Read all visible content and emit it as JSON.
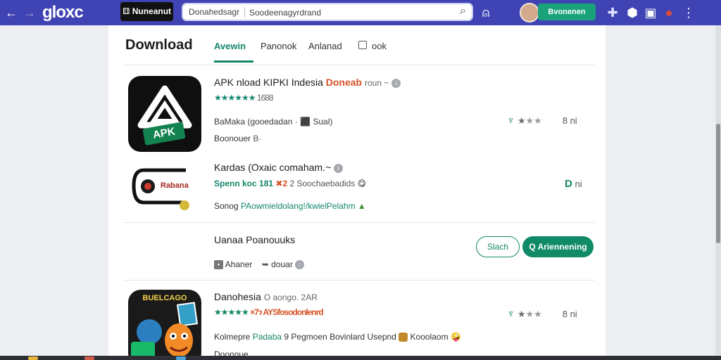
{
  "topbar": {
    "back_icon": "←",
    "forward_icon": "→",
    "brand": "gloxc",
    "logo_text": "⚅ Nuneanut",
    "search_scope": "Donahedsagr",
    "search_value": "Soodeenagyrdrand",
    "search_icon": "⌕",
    "notify_icon": "⍝",
    "account_button": "Bvonenen",
    "icons": [
      "✚",
      "⬢",
      "▣",
      "●",
      "⋮"
    ]
  },
  "page": {
    "title": "Download"
  },
  "tabs": [
    "Avewin",
    "Panonok",
    "Anlanad",
    "ook"
  ],
  "apps": [
    {
      "name_prefix": "APK nload KIPKI Indesia",
      "name_highlight": "Doneab",
      "name_suffix": "roun ~",
      "rating_count": "1688",
      "meta_line": "BaMaka (gooedadan · ⬛ Sual)",
      "developer": "Boonouer",
      "developer_suffix": "B·",
      "rating_value": "8 ni"
    },
    {
      "name": "Kardas (Oxaic comaham.~",
      "stats_teal": "Spenn koc 181",
      "stats_mid": "2 Soochaebadids",
      "meta_line": "Sonog",
      "meta_link": "PAowmieldolang!/kwielPelahm",
      "badge": "D",
      "rating_value": "ni",
      "logo_text": "Rabana"
    },
    {
      "name": "Uanaa Poanouuks",
      "meta_left": "Ahaner",
      "meta_mid": "douar",
      "button_outline": "Slach",
      "button_fill": "Q Ariennening"
    },
    {
      "name": "Danohesia",
      "name_suffix": "O aongo. 2AR",
      "stats": "×7ɂ AYSfosodonlenrd",
      "meta_prefix": "Kolmepre",
      "meta_link": "Padaba",
      "meta_mid": "9 Pegmoen Bovinlard Usepnd",
      "meta_tail": "Kooolaom",
      "developer": "Doonnue",
      "rating_value": "8 ni",
      "logo_text": "BUELCAGO"
    }
  ],
  "colors": {
    "topbar": "#3f43b3",
    "accent": "#13866a",
    "highlight": "#d65227"
  }
}
